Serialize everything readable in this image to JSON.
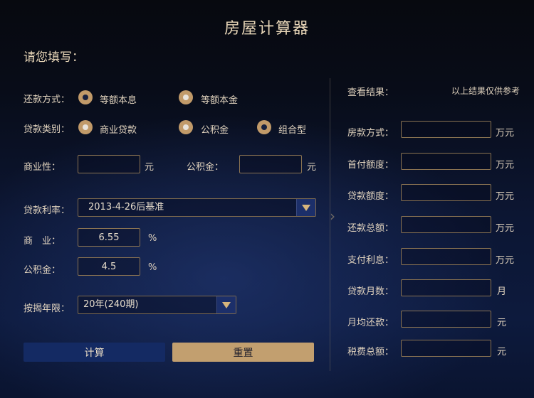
{
  "title": "房屋计算器",
  "subtitle": "请您填写：",
  "form": {
    "repayment": {
      "label": "还款方式：",
      "options": [
        {
          "label": "等额本息",
          "selected": true
        },
        {
          "label": "等额本金",
          "selected": false
        }
      ]
    },
    "loan_type": {
      "label": "贷款类别：",
      "options": [
        {
          "label": "商业贷款",
          "selected": false
        },
        {
          "label": "公积金",
          "selected": false
        },
        {
          "label": "组合型",
          "selected": true
        }
      ]
    },
    "commercial_amount": {
      "label": "商业性：",
      "value": "",
      "unit": "元"
    },
    "fund_amount": {
      "label": "公积金：",
      "value": "",
      "unit": "元"
    },
    "rate": {
      "label": "贷款利率：",
      "selected": "2013-4-26后基准"
    },
    "commercial_rate": {
      "label": "商　业：",
      "value": "6.55",
      "unit": "%"
    },
    "fund_rate": {
      "label": "公积金：",
      "value": "4.5",
      "unit": "%"
    },
    "term": {
      "label": "按揭年限：",
      "selected": "20年(240期)"
    },
    "calc_label": "计算",
    "reset_label": "重置"
  },
  "results": {
    "header": "查看结果：",
    "note": "以上结果仅供参考",
    "items": [
      {
        "label": "房款方式：",
        "value": "",
        "unit": "万元"
      },
      {
        "label": "首付额度：",
        "value": "",
        "unit": "万元"
      },
      {
        "label": "贷款额度：",
        "value": "",
        "unit": "万元"
      },
      {
        "label": "还款总额：",
        "value": "",
        "unit": "万元"
      },
      {
        "label": "支付利息：",
        "value": "",
        "unit": "万元"
      },
      {
        "label": "贷款月数：",
        "value": "",
        "unit": "月"
      },
      {
        "label": "月均还款：",
        "value": "",
        "unit": "元"
      },
      {
        "label": "税费总额：",
        "value": "",
        "unit": "元"
      }
    ]
  },
  "colors": {
    "accent_gold": "#c29f6f",
    "button_blue": "#142a63",
    "select_arrow_bg": "#1c2f6a"
  },
  "icons": {
    "dropdown": "triangle-down-icon",
    "divider_arrow": "chevron-right-icon"
  }
}
